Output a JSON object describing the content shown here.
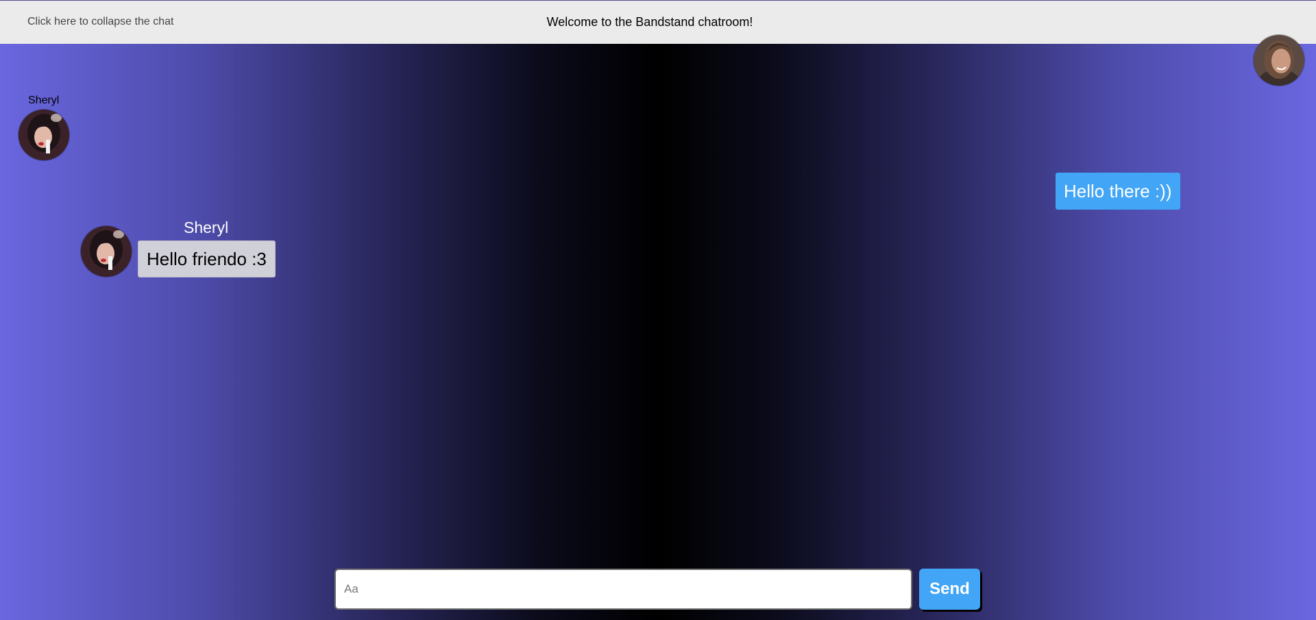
{
  "header": {
    "collapse_label": "Click here to collapse the chat",
    "title": "Welcome to the Bandstand chatroom!"
  },
  "users": {
    "self": {
      "avatar_icon": "user-avatar-photo"
    },
    "sheryl": {
      "name": "Sheryl",
      "avatar_icon": "user-avatar-photo"
    }
  },
  "messages": [
    {
      "sender": "Sheryl",
      "text": "Hello friendo :3",
      "direction": "incoming"
    },
    {
      "sender": "self",
      "text": "Hello there :))",
      "direction": "outgoing"
    }
  ],
  "composer": {
    "placeholder": "Aa",
    "value": "",
    "send_label": "Send"
  },
  "colors": {
    "accent": "#42a5f5",
    "incoming_bubble": "#d0d0d8",
    "header_bg": "#ebebeb",
    "gradient_edge": "#6a67e0",
    "gradient_center": "#000000"
  }
}
